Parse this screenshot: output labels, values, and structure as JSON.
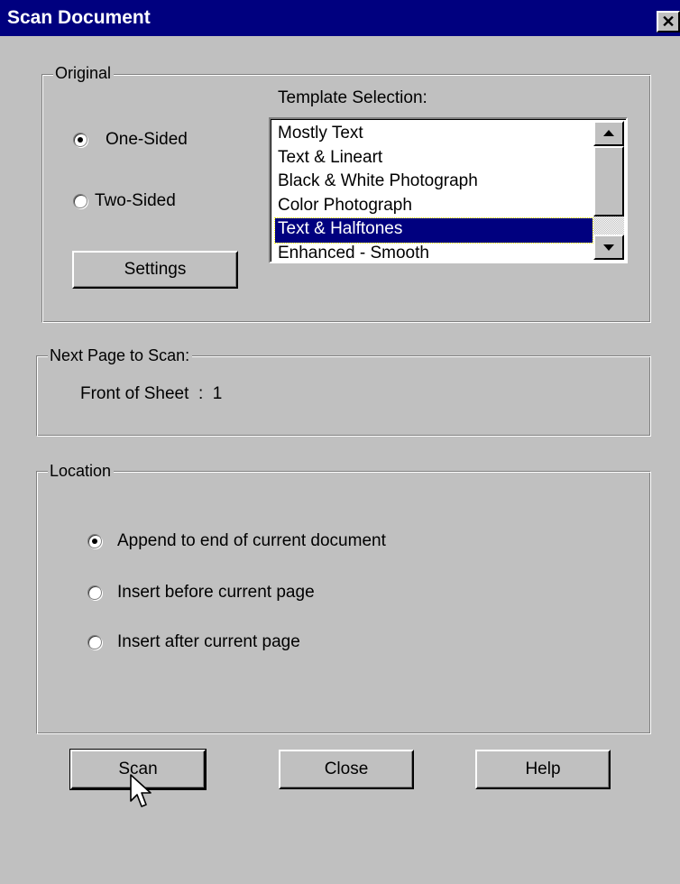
{
  "window": {
    "title": "Scan Document",
    "close_glyph": "✕"
  },
  "original": {
    "legend": "Original",
    "one_sided_label": "One-Sided",
    "two_sided_label": "Two-Sided",
    "selected_side": "One-Sided",
    "settings_label": "Settings",
    "template_label": "Template Selection:",
    "templates": [
      "Mostly Text",
      "Text & Lineart",
      "Black & White Photograph",
      "Color Photograph",
      "Text & Halftones",
      "Enhanced - Smooth"
    ],
    "selected_template": "Text & Halftones"
  },
  "next_page": {
    "legend": "Next Page to Scan:",
    "value": "Front of Sheet  :  1"
  },
  "location": {
    "legend": "Location",
    "options": [
      "Append to end of current document",
      "Insert before current page",
      "Insert after current page"
    ],
    "selected": "Append to end of current document"
  },
  "buttons": {
    "scan": "Scan",
    "close": "Close",
    "help": "Help"
  },
  "icons": {
    "scroll_up": "triangle-up-icon",
    "scroll_down": "triangle-down-icon",
    "cursor": "arrow-cursor-icon"
  },
  "colors": {
    "face": "#c0c0c0",
    "titlebar": "#00007f",
    "selection": "#00007f"
  }
}
